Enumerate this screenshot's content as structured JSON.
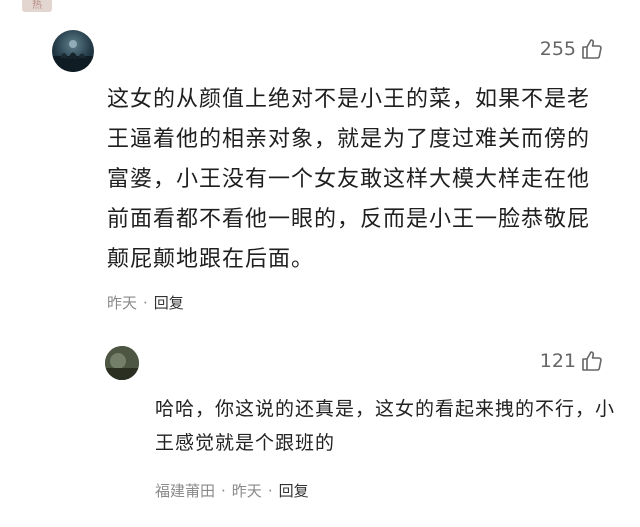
{
  "top_tag": "热",
  "comment": {
    "likes": "255",
    "text": "这女的从颜值上绝对不是小王的菜，如果不是老王逼着他的相亲对象，就是为了度过难关而傍的富婆，小王没有一个女友敢这样大模大样走在他前面看都不看他一眼的，反而是小王一脸恭敬屁颠屁颠地跟在后面。",
    "time": "昨天",
    "separator": "·",
    "reply_label": "回复"
  },
  "reply": {
    "likes": "121",
    "text": "哈哈，你这说的还真是，这女的看起来拽的不行，小王感觉就是个跟班的",
    "location": "福建莆田",
    "separator": "·",
    "time": "昨天",
    "reply_label": "回复"
  },
  "icons": {
    "like": "thumbs-up-icon",
    "avatar": "user-avatar"
  }
}
